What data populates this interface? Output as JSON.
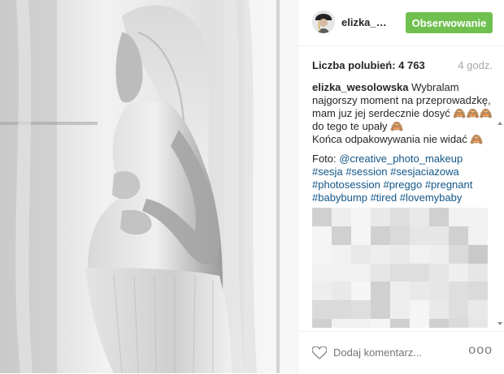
{
  "post": {
    "username": "elizka_we...",
    "follow_label": "Obserwowanie",
    "likes_text": "Liczba polubień: 4 763",
    "time_text": "4 godz.",
    "caption": {
      "username": "elizka_wesolowska",
      "text": "Wybralam najgorszy moment na przeprowadzkę, mam juz jej serdecznie dosyć",
      "emoji_1": "🙈🙈🙈",
      "text_2": "do tego te upały",
      "emoji_2": "🙈",
      "text_3": "Końca odpakowywania nie widać",
      "emoji_3": "🙈",
      "foto_label": "Foto:",
      "foto_handle": "@creative_photo_makeup",
      "hashtags": [
        "#sesja",
        "#session",
        "#sesjaciazowa",
        "#photosession",
        "#preggo",
        "#pregnant",
        "#babybump",
        "#tired",
        "#lovemybaby"
      ]
    },
    "comment_placeholder": "Dodaj komentarz...",
    "more_label": "ooo",
    "colors": {
      "follow_green": "#70c050",
      "link_blue": "#125688",
      "meta_gray": "#a5a7aa"
    },
    "icons": {
      "heart": "heart-outline-icon",
      "more": "more-options-icon"
    }
  }
}
